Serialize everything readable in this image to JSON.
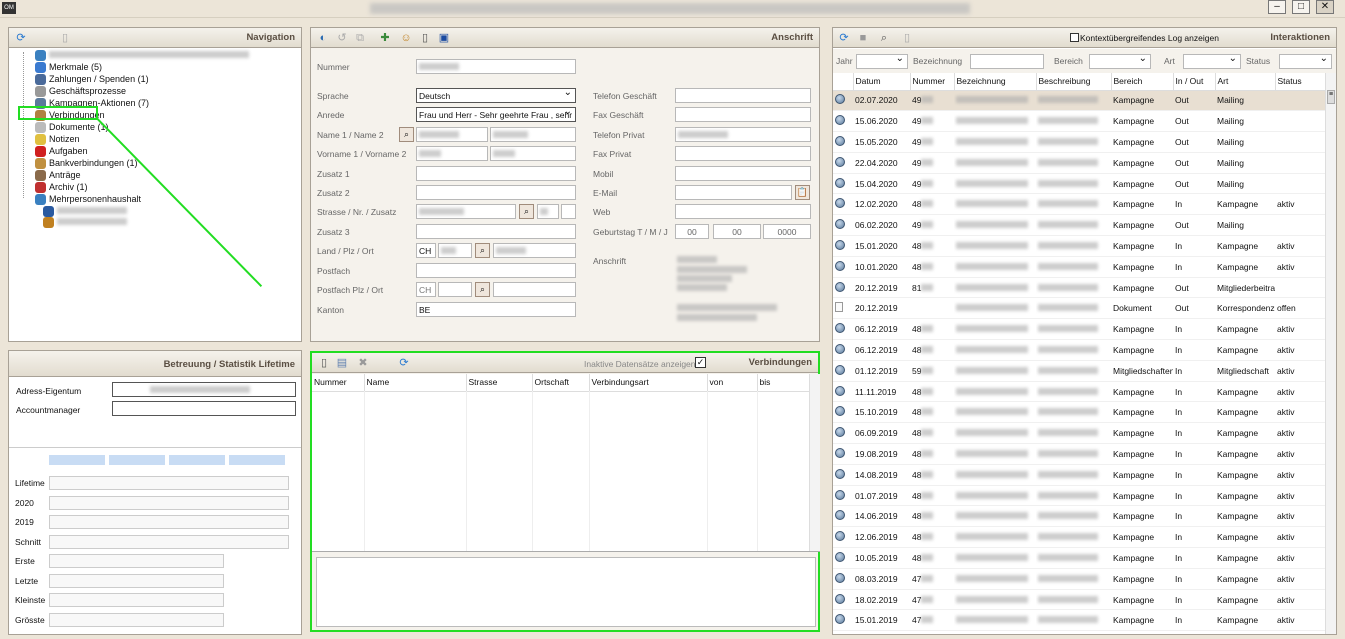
{
  "window": {
    "app_icon": "OM",
    "buttons": [
      "–",
      "□",
      "✕"
    ]
  },
  "navigation": {
    "title": "Navigation",
    "icons": [
      "refresh-icon",
      "document-icon"
    ],
    "items": [
      {
        "label": "",
        "blurred": true
      },
      {
        "label": "Merkmale (5)"
      },
      {
        "label": "Zahlungen / Spenden (1)"
      },
      {
        "label": "Geschäftsprozesse"
      },
      {
        "label": "Kampagnen-Aktionen (7)"
      },
      {
        "label": "Verbindungen",
        "selected": true
      },
      {
        "label": "Dokumente (1)"
      },
      {
        "label": "Notizen"
      },
      {
        "label": "Aufgaben"
      },
      {
        "label": "Bankverbindungen (1)"
      },
      {
        "label": "Anträge"
      },
      {
        "label": "Archiv (1)"
      },
      {
        "label": "Mehrpersonenhaushalt"
      }
    ],
    "highlight_color": "#22dd22"
  },
  "stats": {
    "title": "Betreuung / Statistik Lifetime",
    "adress_eigentum_label": "Adress-Eigentum",
    "accountmanager_label": "Accountmanager",
    "row_labels": [
      "Lifetime",
      "2020",
      "2019",
      "Schnitt",
      "Erste",
      "Letzte",
      "Kleinste",
      "Grösste"
    ]
  },
  "anschrift": {
    "title": "Anschrift",
    "labels": {
      "nummer": "Nummer",
      "sprache": "Sprache",
      "anrede": "Anrede",
      "name": "Name 1 / Name 2",
      "vorname": "Vorname 1 / Vorname 2",
      "zusatz1": "Zusatz 1",
      "zusatz2": "Zusatz 2",
      "strasse": "Strasse / Nr. / Zusatz",
      "zusatz3": "Zusatz 3",
      "land": "Land / Plz / Ort",
      "postfach": "Postfach",
      "postfach_plz": "Postfach Plz / Ort",
      "kanton": "Kanton",
      "tel_g": "Telefon Geschäft",
      "fax_g": "Fax Geschäft",
      "tel_p": "Telefon Privat",
      "fax_p": "Fax Privat",
      "mobil": "Mobil",
      "email": "E-Mail",
      "web": "Web",
      "geburtstag": "Geburtstag T / M / J",
      "anschrift": "Anschrift"
    },
    "values": {
      "sprache": "Deutsch",
      "anrede": "Frau und Herr -  Sehr geehrte Frau , sehr",
      "land": "CH",
      "postfach_land": "CH",
      "kanton": "BE",
      "geb_t": "00",
      "geb_m": "00",
      "geb_j": "0000"
    }
  },
  "verbindungen": {
    "title": "Verbindungen",
    "inactive_label": "Inaktive Datensätze anzeigen",
    "inactive_checked": true,
    "columns": [
      "Nummer",
      "Name",
      "Strasse",
      "Ortschaft",
      "Verbindungsart",
      "von",
      "bis"
    ]
  },
  "interaktionen": {
    "title": "Interaktionen",
    "context_log_label": "Kontextübergreifendes Log anzeigen",
    "context_log_checked": false,
    "filters": {
      "jahr": "Jahr",
      "bezeichnung": "Bezeichnung",
      "bereich": "Bereich",
      "art": "Art",
      "status": "Status"
    },
    "columns": [
      "Datum",
      "Nummer",
      "Bezeichnung",
      "Beschreibung",
      "Bereich",
      "In / Out",
      "Art",
      "Status"
    ],
    "rows": [
      {
        "icon": "globe",
        "datum": "02.07.2020",
        "nummer": "49",
        "bereich": "Kampagne",
        "inout": "Out",
        "art": "Mailing",
        "status": ""
      },
      {
        "icon": "globe",
        "datum": "15.06.2020",
        "nummer": "49",
        "bereich": "Kampagne",
        "inout": "Out",
        "art": "Mailing",
        "status": ""
      },
      {
        "icon": "globe",
        "datum": "15.05.2020",
        "nummer": "49",
        "bereich": "Kampagne",
        "inout": "Out",
        "art": "Mailing",
        "status": ""
      },
      {
        "icon": "globe",
        "datum": "22.04.2020",
        "nummer": "49",
        "bereich": "Kampagne",
        "inout": "Out",
        "art": "Mailing",
        "status": ""
      },
      {
        "icon": "globe",
        "datum": "15.04.2020",
        "nummer": "49",
        "bereich": "Kampagne",
        "inout": "Out",
        "art": "Mailing",
        "status": ""
      },
      {
        "icon": "globe",
        "datum": "12.02.2020",
        "nummer": "48",
        "bereich": "Kampagne",
        "inout": "In",
        "art": "Kampagne",
        "status": "aktiv"
      },
      {
        "icon": "globe",
        "datum": "06.02.2020",
        "nummer": "49",
        "bereich": "Kampagne",
        "inout": "Out",
        "art": "Mailing",
        "status": ""
      },
      {
        "icon": "globe",
        "datum": "15.01.2020",
        "nummer": "48",
        "bereich": "Kampagne",
        "inout": "In",
        "art": "Kampagne",
        "status": "aktiv"
      },
      {
        "icon": "globe",
        "datum": "10.01.2020",
        "nummer": "48",
        "bereich": "Kampagne",
        "inout": "In",
        "art": "Kampagne",
        "status": "aktiv"
      },
      {
        "icon": "globe",
        "datum": "20.12.2019",
        "nummer": "81",
        "bereich": "Kampagne",
        "inout": "Out",
        "art": "Mitgliederbeitrag",
        "status": ""
      },
      {
        "icon": "doc",
        "datum": "20.12.2019",
        "nummer": "",
        "bereich": "Dokument",
        "inout": "Out",
        "art": "Korrespondenz",
        "status": "offen"
      },
      {
        "icon": "globe",
        "datum": "06.12.2019",
        "nummer": "48",
        "bereich": "Kampagne",
        "inout": "In",
        "art": "Kampagne",
        "status": "aktiv"
      },
      {
        "icon": "globe",
        "datum": "06.12.2019",
        "nummer": "48",
        "bereich": "Kampagne",
        "inout": "In",
        "art": "Kampagne",
        "status": "aktiv"
      },
      {
        "icon": "globe",
        "datum": "01.12.2019",
        "nummer": "59",
        "bereich": "Mitgliedschaften",
        "inout": "In",
        "art": "Mitgliedschaft",
        "status": "aktiv"
      },
      {
        "icon": "globe",
        "datum": "11.11.2019",
        "nummer": "48",
        "bereich": "Kampagne",
        "inout": "In",
        "art": "Kampagne",
        "status": "aktiv"
      },
      {
        "icon": "globe",
        "datum": "15.10.2019",
        "nummer": "48",
        "bereich": "Kampagne",
        "inout": "In",
        "art": "Kampagne",
        "status": "aktiv"
      },
      {
        "icon": "globe",
        "datum": "06.09.2019",
        "nummer": "48",
        "bereich": "Kampagne",
        "inout": "In",
        "art": "Kampagne",
        "status": "aktiv"
      },
      {
        "icon": "globe",
        "datum": "19.08.2019",
        "nummer": "48",
        "bereich": "Kampagne",
        "inout": "In",
        "art": "Kampagne",
        "status": "aktiv"
      },
      {
        "icon": "globe",
        "datum": "14.08.2019",
        "nummer": "48",
        "bereich": "Kampagne",
        "inout": "In",
        "art": "Kampagne",
        "status": "aktiv"
      },
      {
        "icon": "globe",
        "datum": "01.07.2019",
        "nummer": "48",
        "bereich": "Kampagne",
        "inout": "In",
        "art": "Kampagne",
        "status": "aktiv"
      },
      {
        "icon": "globe",
        "datum": "14.06.2019",
        "nummer": "48",
        "bereich": "Kampagne",
        "inout": "In",
        "art": "Kampagne",
        "status": "aktiv"
      },
      {
        "icon": "globe",
        "datum": "12.06.2019",
        "nummer": "48",
        "bereich": "Kampagne",
        "inout": "In",
        "art": "Kampagne",
        "status": "aktiv"
      },
      {
        "icon": "globe",
        "datum": "10.05.2019",
        "nummer": "48",
        "bereich": "Kampagne",
        "inout": "In",
        "art": "Kampagne",
        "status": "aktiv"
      },
      {
        "icon": "globe",
        "datum": "08.03.2019",
        "nummer": "47",
        "bereich": "Kampagne",
        "inout": "In",
        "art": "Kampagne",
        "status": "aktiv"
      },
      {
        "icon": "globe",
        "datum": "18.02.2019",
        "nummer": "47",
        "bereich": "Kampagne",
        "inout": "In",
        "art": "Kampagne",
        "status": "aktiv"
      },
      {
        "icon": "globe",
        "datum": "15.01.2019",
        "nummer": "47",
        "bereich": "Kampagne",
        "inout": "In",
        "art": "Kampagne",
        "status": "aktiv"
      }
    ]
  }
}
